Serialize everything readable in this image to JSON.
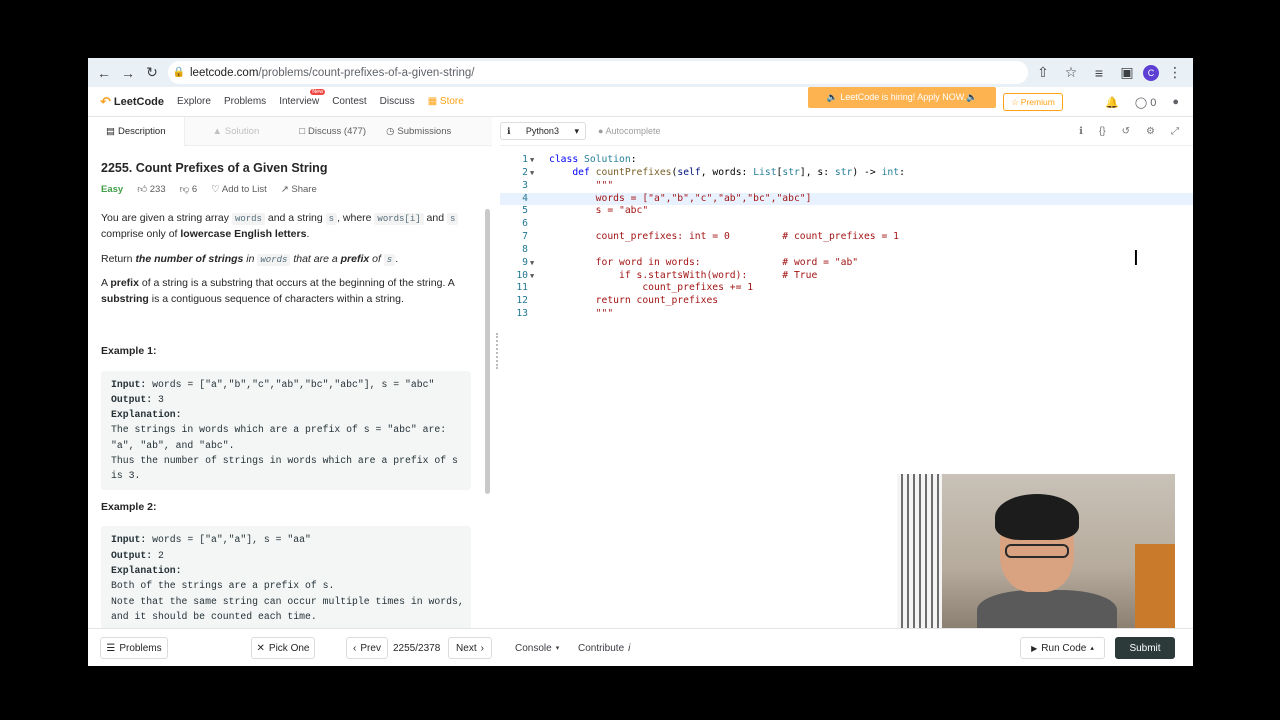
{
  "browser": {
    "url_host": "leetcode.com",
    "url_path": "/problems/count-prefixes-of-a-given-string/",
    "profile_initial": "C"
  },
  "nav": {
    "logo": "LeetCode",
    "links": [
      "Explore",
      "Problems",
      "Interview",
      "Contest",
      "Discuss",
      "Store"
    ],
    "new_badge": "New",
    "hiring": "🔈 LeetCode is hiring! Apply NOW.🔈",
    "premium": "Premium",
    "points": "0"
  },
  "tabs": {
    "description": "Description",
    "solution": "Solution",
    "discuss": "Discuss (477)",
    "submissions": "Submissions"
  },
  "problem": {
    "title": "2255. Count Prefixes of a Given String",
    "difficulty": "Easy",
    "likes": "233",
    "dislikes": "6",
    "add_to_list": "Add to List",
    "share": "Share",
    "p1_a": "You are given a string array ",
    "p1_words": "words",
    "p1_b": " and a string ",
    "p1_s": "s",
    "p1_c": ", where ",
    "p1_wi": "words[i]",
    "p1_d": " and ",
    "p1_s2": "s",
    "p1_e": " comprise only of ",
    "p1_bold": "lowercase English letters",
    "p1_f": ".",
    "p2_a": "Return ",
    "p2_bi1": "the number of strings",
    "p2_i1": " in ",
    "p2_words": "words",
    "p2_i2": " that are a ",
    "p2_bi2": "prefix",
    "p2_i3": " of ",
    "p2_s": "s",
    "p2_end": ".",
    "p3_a": "A ",
    "p3_b1": "prefix",
    "p3_c": " of a string is a substring that occurs at the beginning of the string. A ",
    "p3_b2": "substring",
    "p3_d": " is a contiguous sequence of characters within a string.",
    "example1_title": "Example 1:",
    "example1": {
      "input_label": "Input:",
      "input": " words = [\"a\",\"b\",\"c\",\"ab\",\"bc\",\"abc\"], s = \"abc\"",
      "output_label": "Output:",
      "output": " 3",
      "expl_label": "Explanation:",
      "expl": "The strings in words which are a prefix of s = \"abc\" are:\n\"a\", \"ab\", and \"abc\".\nThus the number of strings in words which are a prefix of s\nis 3."
    },
    "example2_title": "Example 2:",
    "example2": {
      "input_label": "Input:",
      "input": " words = [\"a\",\"a\"], s = \"aa\"",
      "output_label": "Output:",
      "output": " 2",
      "expl_label": "Explanation:",
      "expl": "Both of the strings are a prefix of s.\nNote that the same string can occur multiple times in words,\nand it should be counted each time."
    }
  },
  "editor": {
    "language": "Python3",
    "autocomplete": "Autocomplete",
    "lines": [
      "1",
      "2",
      "3",
      "4",
      "5",
      "6",
      "7",
      "8",
      "9",
      "10",
      "11",
      "12",
      "13"
    ]
  },
  "bottom": {
    "problems": "Problems",
    "pick_one": "Pick One",
    "prev": "Prev",
    "page": "2255/2378",
    "next": "Next",
    "console": "Console",
    "contribute": "Contribute",
    "run_code": "Run Code",
    "submit": "Submit"
  }
}
